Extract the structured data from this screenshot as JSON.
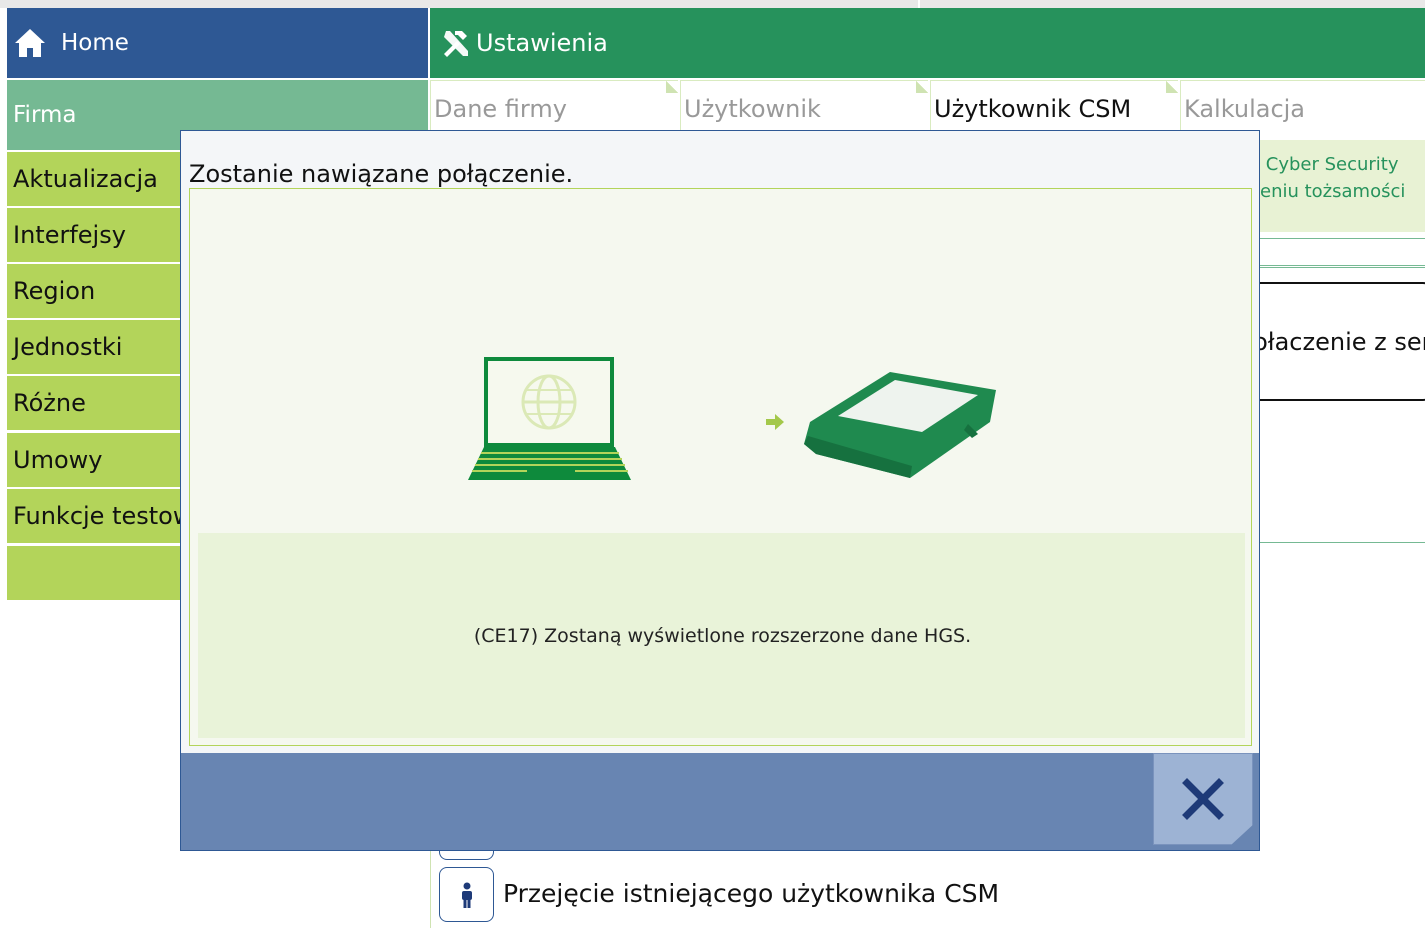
{
  "header": {
    "home_label": "Home",
    "settings_label": "Ustawienia"
  },
  "sidebar": {
    "section": "Firma",
    "items": [
      {
        "label": "Aktualizacja"
      },
      {
        "label": "Interfejsy"
      },
      {
        "label": "Region"
      },
      {
        "label": "Jednostki"
      },
      {
        "label": "Różne"
      },
      {
        "label": "Umowy"
      },
      {
        "label": "Funkcje testow"
      }
    ]
  },
  "tabs": [
    {
      "label": "Dane firmy",
      "active": false
    },
    {
      "label": "Użytkownik",
      "active": false
    },
    {
      "label": "Użytkownik CSM",
      "active": true
    },
    {
      "label": "Kalkulacja",
      "active": false
    }
  ],
  "background_panel": {
    "line1": "ia Cyber Security",
    "line2": "eniu tożsamości"
  },
  "tooltip": {
    "text": "Następuję połaczenie z ser"
  },
  "user_action": {
    "label": "Przejęcie istniejącego użytkownika CSM",
    "icon": "person-icon"
  },
  "modal": {
    "title": "Zostanie nawiązane połączenie.",
    "info": "(CE17) Zostaną wyświetlone rozszerzone dane HGS.",
    "close_icon": "close-icon"
  },
  "colors": {
    "home_blue": "#2e5894",
    "settings_green": "#26925c",
    "firma_green": "#75b993",
    "sidebar_lime": "#b3d45a",
    "modal_footer": "#6885b2",
    "close_button": "#9db3d4",
    "info_panel": "#e9f3d9"
  }
}
